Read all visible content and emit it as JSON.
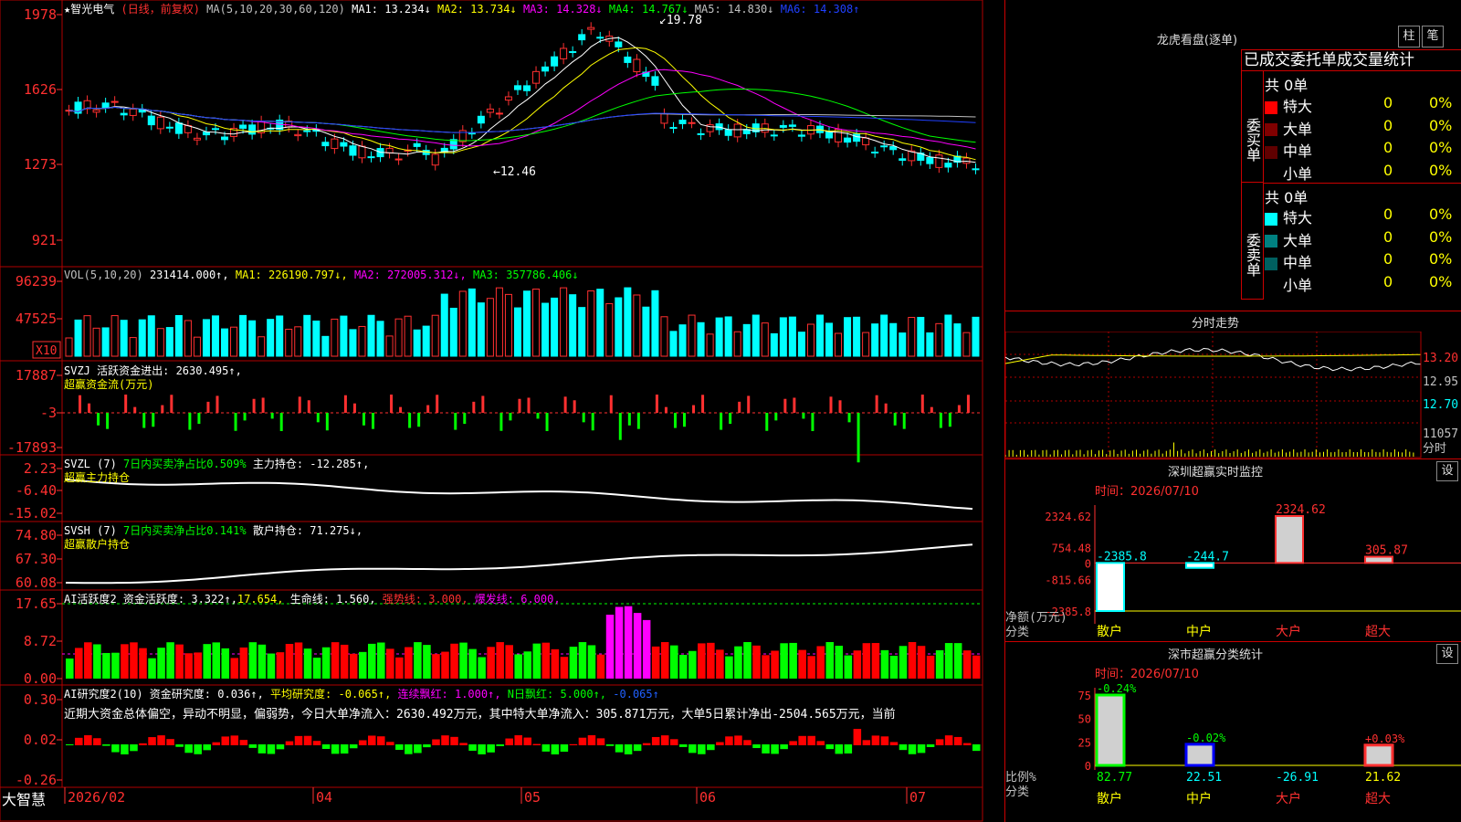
{
  "stock": {
    "name": "★智光电气",
    "mode": "(日线，前复权)",
    "ma_header": "MA(5,10,20,30,60,120)",
    "ma": [
      {
        "label": "MA1:",
        "value": "13.234↓",
        "color": "#ffffff"
      },
      {
        "label": "MA2:",
        "value": "13.734↓",
        "color": "#ffff00"
      },
      {
        "label": "MA3:",
        "value": "14.328↓",
        "color": "#ff00ff"
      },
      {
        "label": "MA4:",
        "value": "14.767↓",
        "color": "#00ff00"
      },
      {
        "label": "MA5:",
        "value": "14.830↓",
        "color": "#c0c0c0"
      },
      {
        "label": "MA6:",
        "value": "14.308↑",
        "color": "#2040ff"
      }
    ],
    "price_ticks": [
      "1978",
      "1626",
      "1273",
      "921"
    ],
    "high_label": "19.78",
    "low_label": "12.46"
  },
  "vol": {
    "header": "VOL(5,10,20)",
    "value": "231414.000↑,",
    "ma1": "MA1: 226190.797↓,",
    "ma2": "MA2: 272005.312↓,",
    "ma3": "MA3: 357786.406↓",
    "ticks": [
      "96239",
      "47525"
    ],
    "unit": "X10"
  },
  "svzj": {
    "header": "SVZJ  活跃资金进出: 2630.495↑,",
    "sub": "超赢资金流(万元)",
    "ticks": [
      "17887",
      "-3",
      "-17893"
    ]
  },
  "svzl": {
    "header_a": "SVZL (7) ",
    "header_b": "7日内买卖净占比0.509%",
    "header_c": " 主力持仓: -12.285↑,",
    "sub": "超赢主力持仓",
    "ticks": [
      "2.23",
      "-6.40",
      "-15.02"
    ]
  },
  "svsh": {
    "header_a": "SVSH (7) ",
    "header_b": "7日内买卖净占比0.141%",
    "header_c": " 散户持仓: 71.275↓,",
    "sub": "超赢散户持仓",
    "ticks": [
      "74.80",
      "67.30",
      "60.08"
    ]
  },
  "ai2": {
    "h1": "AI活跃度2 资金活跃度: 3.322↑,",
    "h2": "17.654,",
    "h3": " 生命线: 1.560,",
    "h4": " 强势线: 3.000,",
    "h5": " 爆发线: 6.000,",
    "ticks": [
      "17.65",
      "8.72",
      "0.00"
    ]
  },
  "ai_research": {
    "h1": "AI研究度2(10) 资金研究度: 0.036↑,",
    "h2": " 平均研究度: -0.065↑,",
    "h3": " 连续飘红: 1.000↑,",
    "h4": " N日飘红: 5.000↑,",
    "h5": " -0.065↑",
    "comment": "近期大资金总体偏空，异动不明显，偏弱势，今日大单净流入：2630.492万元，其中特大单净流入：305.871万元，大单5日累计净出-2504.565万元，当前",
    "ticks": [
      "0.30",
      "0.02",
      "-0.26"
    ]
  },
  "xaxis": {
    "labels": [
      "2026/02",
      "04",
      "05",
      "06",
      "07"
    ],
    "brand": "大智慧"
  },
  "lhb": {
    "title": "龙虎看盘(逐单)",
    "btn1": "柱",
    "btn2": "笔",
    "subtitle": "已成交委托单成交量统计",
    "buy_label": "委买单",
    "sell_label": "委卖单",
    "buy_total": "共 0单",
    "sell_total": "共 0单",
    "buy_rows": [
      {
        "name": "特大",
        "count": "0",
        "pct": "0%",
        "color": "#ff0000"
      },
      {
        "name": "大单",
        "count": "0",
        "pct": "0%",
        "color": "#800000"
      },
      {
        "name": "中单",
        "count": "0",
        "pct": "0%",
        "color": "#600000"
      },
      {
        "name": "小单",
        "count": "0",
        "pct": "0%",
        "color": ""
      }
    ],
    "sell_rows": [
      {
        "name": "特大",
        "count": "0",
        "pct": "0%",
        "color": "#00ffff"
      },
      {
        "name": "大单",
        "count": "0",
        "pct": "0%",
        "color": "#008080"
      },
      {
        "name": "中单",
        "count": "0",
        "pct": "0%",
        "color": "#006060"
      },
      {
        "name": "小单",
        "count": "0",
        "pct": "0%",
        "color": ""
      }
    ]
  },
  "intraday": {
    "title": "分时走势",
    "price_ticks": [
      "13.20",
      "12.95",
      "12.70"
    ],
    "vol_tick": "11057",
    "vol_label": "分时"
  },
  "sz_monitor": {
    "title": "深圳超赢实时监控",
    "btn": "设",
    "date": "时间：2026/07/10",
    "ticks": [
      "2324.62",
      "754.48",
      "0",
      "-815.66",
      "-2385.8"
    ],
    "axis_name": "净额(万元)",
    "axis_cat": "分类"
  },
  "sz_stats": {
    "title": "深市超赢分类统计",
    "btn": "设",
    "date": "时间：2026/07/10",
    "ticks": [
      "75",
      "50",
      "25",
      "0"
    ],
    "axis_name": "比例%",
    "axis_cat": "分类"
  },
  "chart_data": [
    {
      "type": "bar",
      "title": "深圳超赢实时监控",
      "categories": [
        "散户",
        "中户",
        "大户",
        "超大"
      ],
      "values": [
        -2385.8,
        -244.7,
        2324.62,
        305.87
      ],
      "ylabel": "净额(万元)",
      "xlabel": "分类",
      "ylim": [
        -2385.8,
        2324.62
      ]
    },
    {
      "type": "bar",
      "title": "深市超赢分类统计",
      "categories": [
        "散户",
        "中户",
        "大户",
        "超大"
      ],
      "series": [
        {
          "values": [
            82.77,
            22.51,
            -26.91,
            21.62
          ]
        },
        {
          "values": [
            -0.24,
            -0.02,
            0,
            0.03
          ]
        }
      ],
      "ylabel": "比例%",
      "xlabel": "分类",
      "ylim": [
        0,
        75
      ]
    }
  ]
}
